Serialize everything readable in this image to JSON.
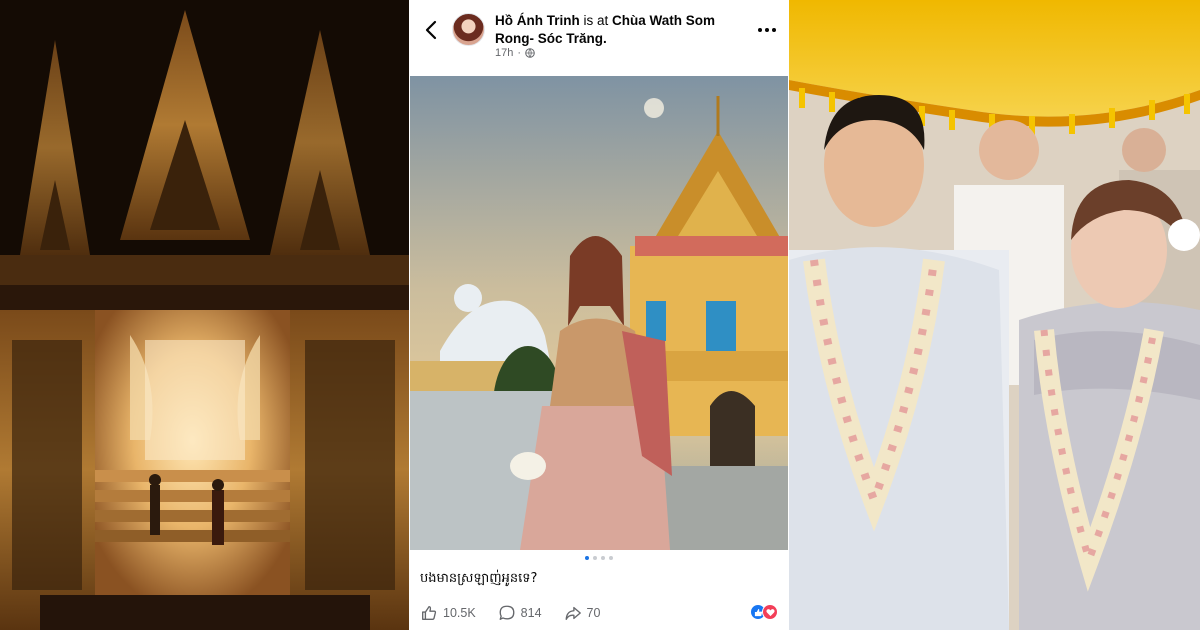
{
  "post": {
    "author": "Hồ Ánh Trinh",
    "checkin_text": "is at",
    "place": "Chùa Wath Som Rong- Sóc Trăng.",
    "time": "17h",
    "privacy_icon": "globe-icon",
    "caption": "បងមានស្រឡាញ់អូនទេ?",
    "carousel": {
      "total": 4,
      "active": 1
    },
    "likes": "10.5K",
    "comments": "814",
    "shares": "70",
    "reactions": [
      "like",
      "love"
    ]
  },
  "colors": {
    "accent": "#1877f2",
    "love": "#f33e58",
    "muted_text": "#65676b",
    "temple_gold": "#d9a441"
  },
  "icons": {
    "back": "chevron-left-icon",
    "more": "more-dots-icon",
    "like": "thumbs-up-icon",
    "comment": "comment-bubble-icon",
    "share": "share-arrow-icon"
  }
}
